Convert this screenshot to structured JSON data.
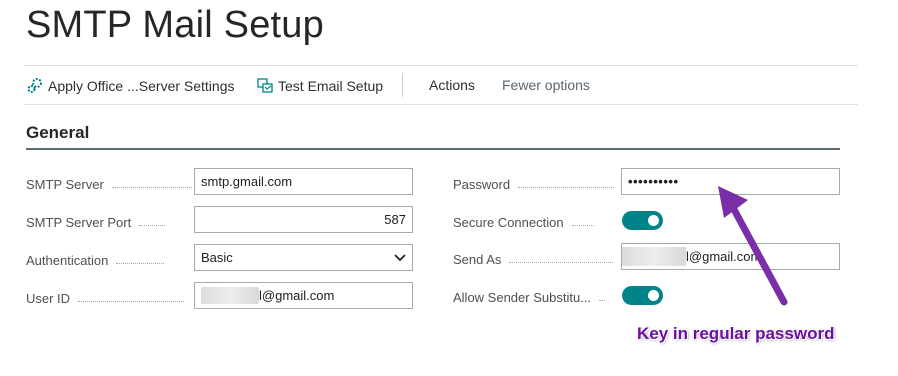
{
  "page": {
    "title": "SMTP Mail Setup"
  },
  "toolbar": {
    "apply_label": "Apply Office ...Server Settings",
    "test_label": "Test Email Setup",
    "actions_label": "Actions",
    "fewer_label": "Fewer options"
  },
  "section": {
    "title": "General"
  },
  "fields": {
    "smtp_server": {
      "label": "SMTP Server",
      "value": "smtp.gmail.com"
    },
    "smtp_port": {
      "label": "SMTP Server Port",
      "value": "587"
    },
    "authentication": {
      "label": "Authentication",
      "value": "Basic"
    },
    "user_id": {
      "label": "User ID",
      "value_suffix": "l@gmail.com"
    },
    "password": {
      "label": "Password",
      "value": "••••••••••"
    },
    "secure_connection": {
      "label": "Secure Connection",
      "on": true
    },
    "send_as": {
      "label": "Send As",
      "value_suffix": "l@gmail.com"
    },
    "allow_sender": {
      "label": "Allow Sender Substitu...",
      "on": true
    }
  },
  "annotation": {
    "text": "Key in regular password",
    "color": "#6a0f9e"
  },
  "colors": {
    "toggle_on": "#00848a",
    "arrow": "#7a2fa8"
  }
}
